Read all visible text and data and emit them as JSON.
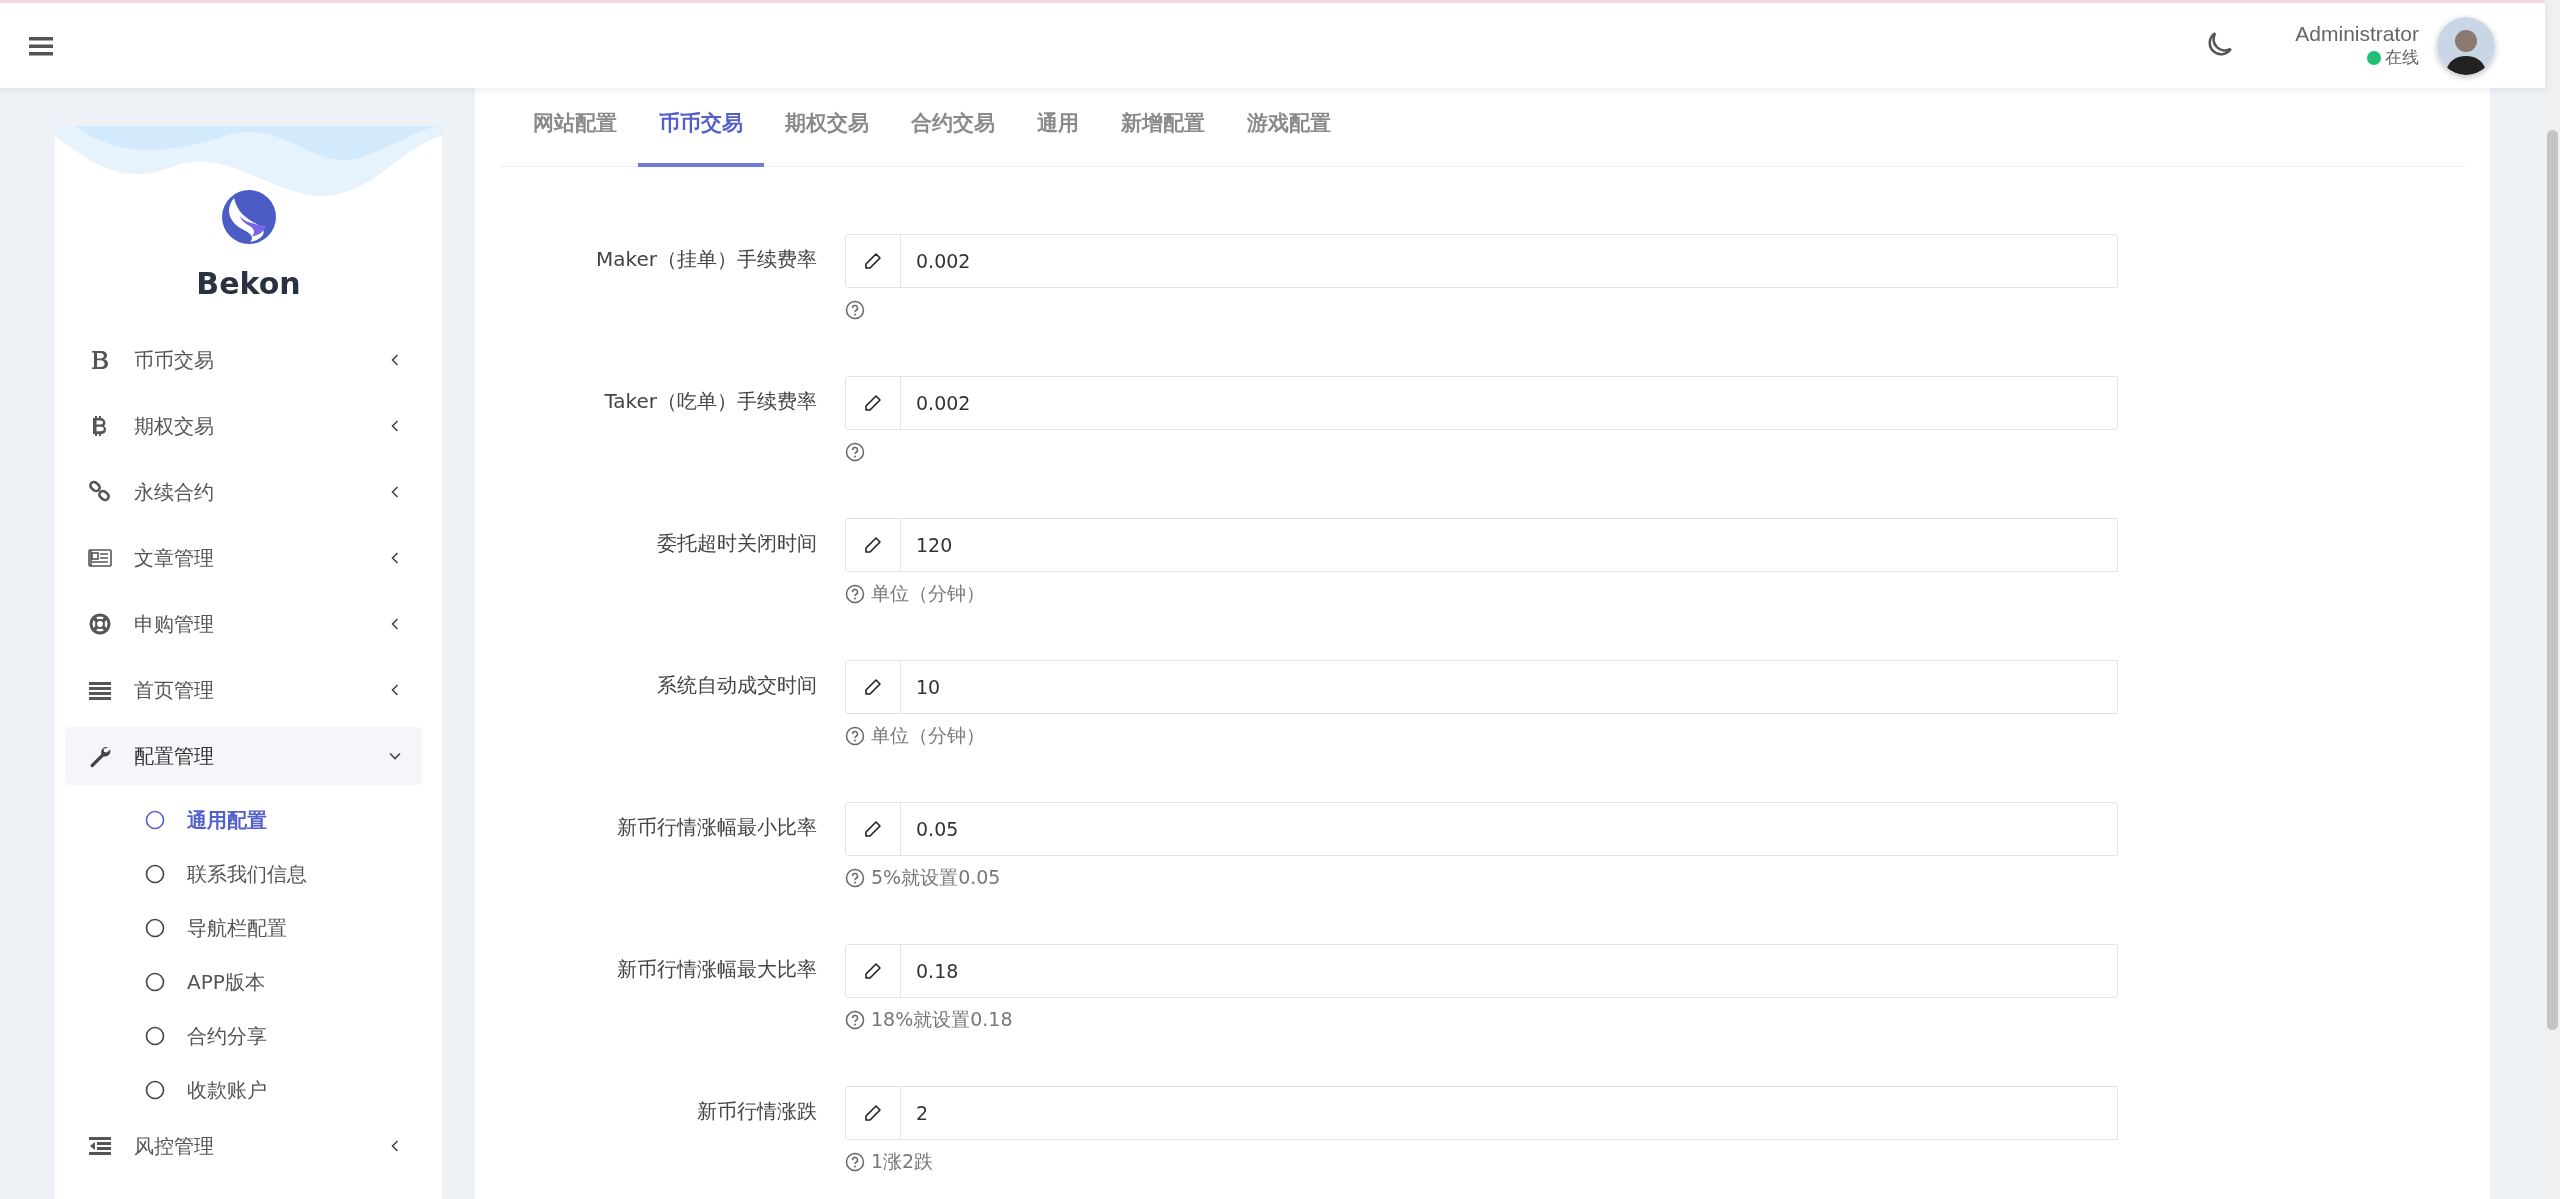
{
  "header": {
    "user": {
      "name": "Administrator",
      "status": "在线"
    }
  },
  "sidebar": {
    "brand": "Bekon",
    "items": [
      {
        "label": "币币交易",
        "expanded": false
      },
      {
        "label": "期权交易",
        "expanded": false
      },
      {
        "label": "永续合约",
        "expanded": false
      },
      {
        "label": "文章管理",
        "expanded": false
      },
      {
        "label": "申购管理",
        "expanded": false
      },
      {
        "label": "首页管理",
        "expanded": false
      },
      {
        "label": "配置管理",
        "expanded": true,
        "children": [
          {
            "label": "通用配置",
            "selected": true
          },
          {
            "label": "联系我们信息",
            "selected": false
          },
          {
            "label": "导航栏配置",
            "selected": false
          },
          {
            "label": "APP版本",
            "selected": false
          },
          {
            "label": "合约分享",
            "selected": false
          },
          {
            "label": "收款账户",
            "selected": false
          }
        ]
      },
      {
        "label": "风控管理",
        "expanded": false
      }
    ]
  },
  "tabs": [
    {
      "label": "网站配置",
      "selected": false
    },
    {
      "label": "币币交易",
      "selected": true
    },
    {
      "label": "期权交易",
      "selected": false
    },
    {
      "label": "合约交易",
      "selected": false
    },
    {
      "label": "通用",
      "selected": false
    },
    {
      "label": "新增配置",
      "selected": false
    },
    {
      "label": "游戏配置",
      "selected": false
    }
  ],
  "form": [
    {
      "label": "Maker（挂单）手续费率",
      "value": "0.002"
    },
    {
      "label": "Taker（吃单）手续费率",
      "value": "0.002"
    },
    {
      "label": "委托超时关闭时间",
      "value": "120",
      "hint": "单位（分钟）"
    },
    {
      "label": "系统自动成交时间",
      "value": "10",
      "hint": "单位（分钟）"
    },
    {
      "label": "新币行情涨幅最小比率",
      "value": "0.05",
      "hint": "5%就设置0.05"
    },
    {
      "label": "新币行情涨幅最大比率",
      "value": "0.18",
      "hint": "18%就设置0.18"
    },
    {
      "label": "新币行情涨跌",
      "value": "2",
      "hint": "1涨2跌"
    }
  ]
}
